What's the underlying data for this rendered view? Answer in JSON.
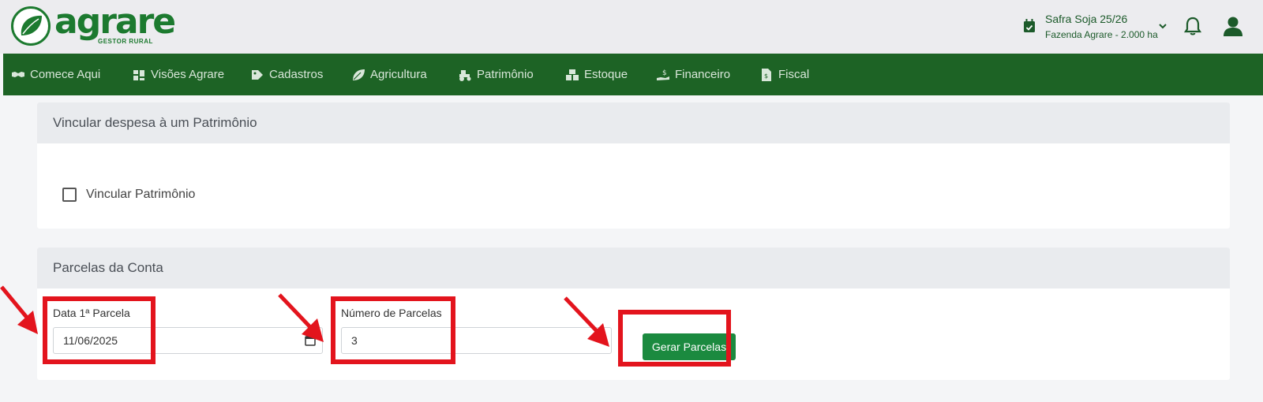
{
  "header": {
    "logo_text": "agrare",
    "logo_sub": "GESTOR RURAL",
    "season": "Safra Soja 25/26",
    "farm": "Fazenda Agrare - 2.000 ha"
  },
  "nav": {
    "items": [
      {
        "label": "Comece Aqui",
        "icon": "handshake-icon"
      },
      {
        "label": "Visões Agrare",
        "icon": "dashboard-icon"
      },
      {
        "label": "Cadastros",
        "icon": "tag-icon"
      },
      {
        "label": "Agricultura",
        "icon": "leaf-icon"
      },
      {
        "label": "Patrimônio",
        "icon": "tractor-icon"
      },
      {
        "label": "Estoque",
        "icon": "boxes-icon"
      },
      {
        "label": "Financeiro",
        "icon": "money-hand-icon"
      },
      {
        "label": "Fiscal",
        "icon": "invoice-icon"
      }
    ]
  },
  "patrimonio_card": {
    "title": "Vincular despesa à um Patrimônio",
    "checkbox_label": "Vincular Patrimônio",
    "checked": false
  },
  "parcelas_card": {
    "title": "Parcelas da Conta",
    "date_label": "Data 1ª Parcela",
    "date_value": "11/06/2025",
    "count_label": "Número de Parcelas",
    "count_value": "3",
    "generate_button": "Gerar Parcelas"
  },
  "colors": {
    "brand_green": "#1c7a2f",
    "nav_green": "#1d6325",
    "button_green": "#1b8a3f",
    "highlight_red": "#e3141d"
  }
}
